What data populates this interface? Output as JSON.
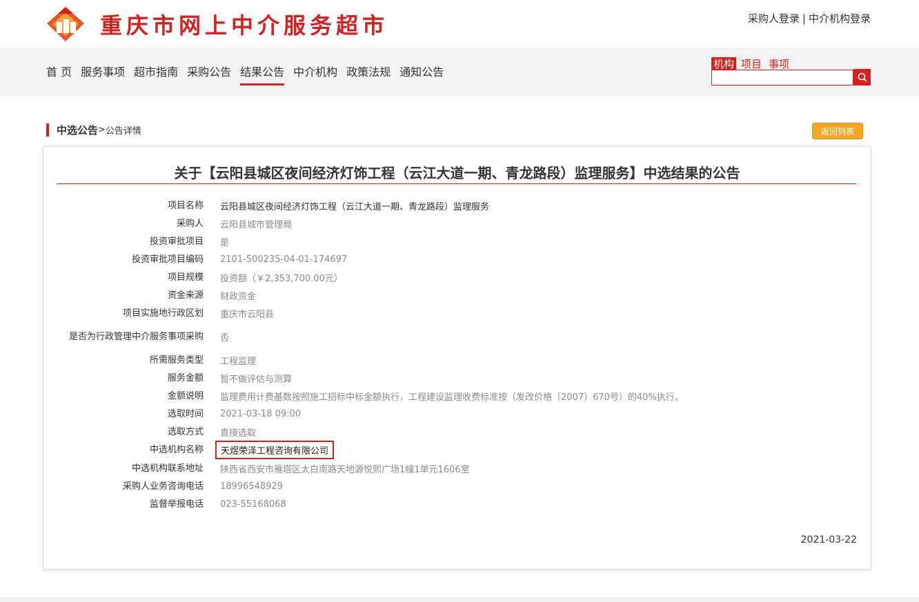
{
  "header": {
    "site_title": "重庆市网上中介服务超市",
    "login_buyer": "采购人登录",
    "login_sep": "|",
    "login_agency": "中介机构登录"
  },
  "nav": {
    "items": [
      "首 页",
      "服务事项",
      "超市指南",
      "采购公告",
      "结果公告",
      "中介机构",
      "政策法规",
      "通知公告"
    ],
    "active": "结果公告"
  },
  "search": {
    "tabs": [
      "机构",
      "项目",
      "事项"
    ],
    "active_tab": "机构",
    "value": ""
  },
  "breadcrumb": {
    "main": "中选公告",
    "sep": ">",
    "sub": "公告详情"
  },
  "back_button": "返回列表",
  "announcement": {
    "title": "关于【云阳县城区夜间经济灯饰工程（云江大道一期、青龙路段）监理服务】中选结果的公告",
    "rows": [
      {
        "label": "项目名称",
        "value": "云阳县城区夜间经济灯饰工程（云江大道一期、青龙路段）监理服务"
      },
      {
        "label": "采购人",
        "value": "云阳县城市管理局"
      },
      {
        "label": "投资审批项目",
        "value": "是"
      },
      {
        "label": "投资审批项目编码",
        "value": "2101-500235-04-01-174697"
      },
      {
        "label": "项目规模",
        "value": "投资额（￥2,353,700.00元）"
      },
      {
        "label": "资金来源",
        "value": "财政资金"
      },
      {
        "label": "项目实施地行政区划",
        "value": "重庆市云阳县"
      },
      {
        "label": "是否为行政管理中介服务事项采购",
        "value": "否"
      },
      {
        "label": "所需服务类型",
        "value": "工程监理"
      },
      {
        "label": "服务金额",
        "value": "暂不做评估与测算"
      },
      {
        "label": "金额说明",
        "value": "监理费用计费基数按照施工招标中标金额执行，工程建设监理收费标准按（发改价格〔2007〕670号）的40%执行。"
      },
      {
        "label": "选取时间",
        "value": "2021-03-18 09:00"
      },
      {
        "label": "选取方式",
        "value": "直接选取"
      },
      {
        "label": "中选机构名称",
        "value": "天煜荣泽工程咨询有限公司"
      },
      {
        "label": "中选机构联系地址",
        "value": "陕西省西安市雁塔区太白南路天地源悦熙广场1幢1单元1606室"
      },
      {
        "label": "采购人业务咨询电话",
        "value": "18996548929"
      },
      {
        "label": "监督举报电话",
        "value": "023-55168068"
      }
    ],
    "date": "2021-03-22"
  },
  "colors": {
    "brand_red": "#d7201e",
    "button_orange": "#f5a623",
    "nav_bg": "#f2f2f2"
  },
  "icons": {
    "logo": "house-logo-icon",
    "search": "search-icon"
  }
}
